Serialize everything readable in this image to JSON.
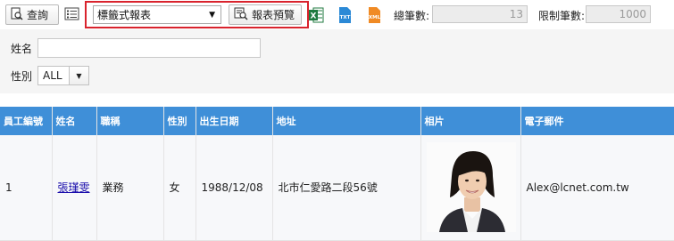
{
  "toolbar": {
    "query_label": "查詢",
    "report_type": "標籤式報表",
    "preview_label": "報表預覽",
    "total_label": "總筆數:",
    "total_value": "13",
    "limit_label": "限制筆數:",
    "limit_value": "1000"
  },
  "filters": {
    "name_label": "姓名",
    "name_value": "",
    "gender_label": "性別",
    "gender_value": "ALL"
  },
  "table": {
    "headers": [
      "員工編號",
      "姓名",
      "職稱",
      "性別",
      "出生日期",
      "地址",
      "相片",
      "電子郵件"
    ],
    "rows": [
      {
        "id": "1",
        "name": "張瑾雯",
        "title": "業務",
        "gender": "女",
        "birth": "1988/12/08",
        "address": "北市仁愛路二段56號",
        "email": "Alex@lcnet.com.tw"
      }
    ]
  },
  "colors": {
    "header_bg": "#3f8fd8",
    "highlight": "#d9232d",
    "excel": "#1f7a3f",
    "txt": "#2b89d6",
    "xml": "#f08a24"
  },
  "icons": [
    "search-report-icon",
    "list-icon",
    "preview-icon",
    "excel-icon",
    "txt-icon",
    "xml-icon",
    "dropdown-arrow-icon"
  ]
}
